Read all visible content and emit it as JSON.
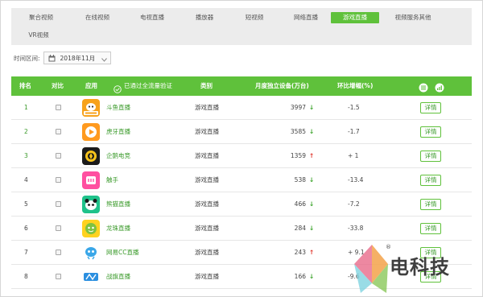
{
  "category_tabs": [
    {
      "label": "聚合视频",
      "active": false
    },
    {
      "label": "在线视频",
      "active": false
    },
    {
      "label": "电视直播",
      "active": false
    },
    {
      "label": "播放器",
      "active": false
    },
    {
      "label": "短视频",
      "active": false
    },
    {
      "label": "网络直播",
      "active": false
    },
    {
      "label": "游戏直播",
      "active": true
    },
    {
      "label": "视频服务其他",
      "active": false
    },
    {
      "label": "VR视频",
      "active": false
    }
  ],
  "time_filter": {
    "label": "时间区间:",
    "value": "2018年11月"
  },
  "table": {
    "headers": {
      "rank": "排名",
      "compare": "对比",
      "app": "应用",
      "filter_checked": "已通过全流量验证",
      "category": "类别",
      "devices": "月度独立设备(万台)",
      "change": "环比增幅(%)"
    },
    "rows": [
      {
        "rank": "1",
        "name": "斗鱼直播",
        "category": "游戏直播",
        "devices": "3997",
        "trend": "↓",
        "trend_dir": "down",
        "change": "-1.5",
        "detail": "详情"
      },
      {
        "rank": "2",
        "name": "虎牙直播",
        "category": "游戏直播",
        "devices": "3585",
        "trend": "↓",
        "trend_dir": "down",
        "change": "-1.7",
        "detail": "详情"
      },
      {
        "rank": "3",
        "name": "企鹅电竞",
        "category": "游戏直播",
        "devices": "1359",
        "trend": "↑",
        "trend_dir": "up",
        "change": "+ 1",
        "detail": "详情"
      },
      {
        "rank": "4",
        "name": "触手",
        "category": "游戏直播",
        "devices": "538",
        "trend": "↓",
        "trend_dir": "down",
        "change": "-13.4",
        "detail": "详情"
      },
      {
        "rank": "5",
        "name": "熊猫直播",
        "category": "游戏直播",
        "devices": "466",
        "trend": "↓",
        "trend_dir": "down",
        "change": "-7.2",
        "detail": "详情"
      },
      {
        "rank": "6",
        "name": "龙珠直播",
        "category": "游戏直播",
        "devices": "284",
        "trend": "↓",
        "trend_dir": "down",
        "change": "-33.8",
        "detail": "详情"
      },
      {
        "rank": "7",
        "name": "网易CC直播",
        "category": "游戏直播",
        "devices": "243",
        "trend": "↑",
        "trend_dir": "up",
        "change": "+ 9.1",
        "detail": "详情"
      },
      {
        "rank": "8",
        "name": "战旗直播",
        "category": "游戏直播",
        "devices": "166",
        "trend": "↓",
        "trend_dir": "down",
        "change": "-9.6",
        "detail": "详情"
      }
    ]
  },
  "watermark": {
    "text": "电科技",
    "registered": "®"
  },
  "colors": {
    "accent": "#5fc13b",
    "link": "#3a9a2a",
    "down": "#3aa32a",
    "up": "#e0342a"
  }
}
